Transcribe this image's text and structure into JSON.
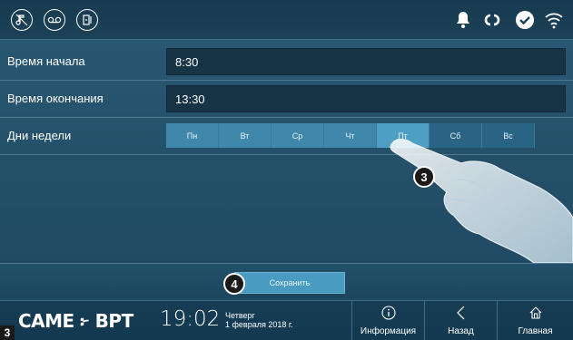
{
  "topbar": {
    "left_icons": [
      "mute-ringer-icon",
      "voicemail-icon",
      "door-entry-icon"
    ],
    "right_icons": [
      "bell-icon",
      "link-icon",
      "check-icon",
      "wifi-icon"
    ]
  },
  "form": {
    "start_label": "Время начала",
    "start_value": "8:30",
    "end_label": "Время окончания",
    "end_value": "13:30",
    "days_label": "Дни недели",
    "days": [
      {
        "label": "Пн",
        "state": "on"
      },
      {
        "label": "Вт",
        "state": "on"
      },
      {
        "label": "Ср",
        "state": "on"
      },
      {
        "label": "Чт",
        "state": "on"
      },
      {
        "label": "Пт",
        "state": "selected"
      },
      {
        "label": "Сб",
        "state": "off"
      },
      {
        "label": "Вс",
        "state": "off"
      }
    ]
  },
  "save": {
    "label": "Сохранить"
  },
  "bottombar": {
    "brand": "CAME ፦ BPT",
    "time": "19:02",
    "weekday": "Четверг",
    "date": "1 февраля 2018 г.",
    "nav": [
      {
        "label": "Информация",
        "icon": "info-icon"
      },
      {
        "label": "Назад",
        "icon": "chevron-left-icon"
      },
      {
        "label": "Главная",
        "icon": "home-icon"
      }
    ]
  },
  "callouts": {
    "tap_step": "3",
    "save_step": "4",
    "figure_number": "3"
  },
  "colors": {
    "accent": "#4a9bc1",
    "background": "#24506a",
    "selected_day": "#4f9fc4"
  }
}
